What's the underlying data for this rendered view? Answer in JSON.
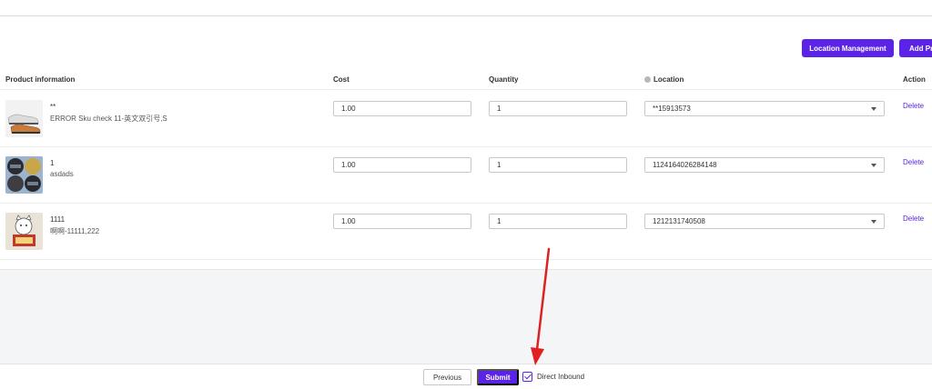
{
  "header": {
    "breadcrumb": ""
  },
  "toolbar": {
    "location_management_label": "Location Management",
    "add_product_label": "Add Pr"
  },
  "table": {
    "columns": {
      "product_information": "Product information",
      "cost": "Cost",
      "quantity": "Quantity",
      "location": "Location",
      "action": "Action"
    },
    "rows": [
      {
        "name": "**",
        "sku": "ERROR Sku check 11-英文双引号,S",
        "cost": "1.00",
        "quantity": "1",
        "location": "**15913573",
        "action": "Delete",
        "thumb_icon": "sneakers-image"
      },
      {
        "name": "1",
        "sku": "asdads",
        "cost": "1.00",
        "quantity": "1",
        "location": "1124164026284148",
        "action": "Delete",
        "thumb_icon": "helmets-image"
      },
      {
        "name": "1111",
        "sku": "啊啊-11111,222",
        "cost": "1.00",
        "quantity": "1",
        "location": "1212131740508",
        "action": "Delete",
        "thumb_icon": "lucky-cat-image"
      }
    ]
  },
  "footer": {
    "previous_label": "Previous",
    "submit_label": "Submit",
    "direct_inbound_label": "Direct Inbound",
    "direct_inbound_checked": true
  },
  "colors": {
    "accent": "#5b23e6",
    "annotation_arrow": "#e02020"
  }
}
